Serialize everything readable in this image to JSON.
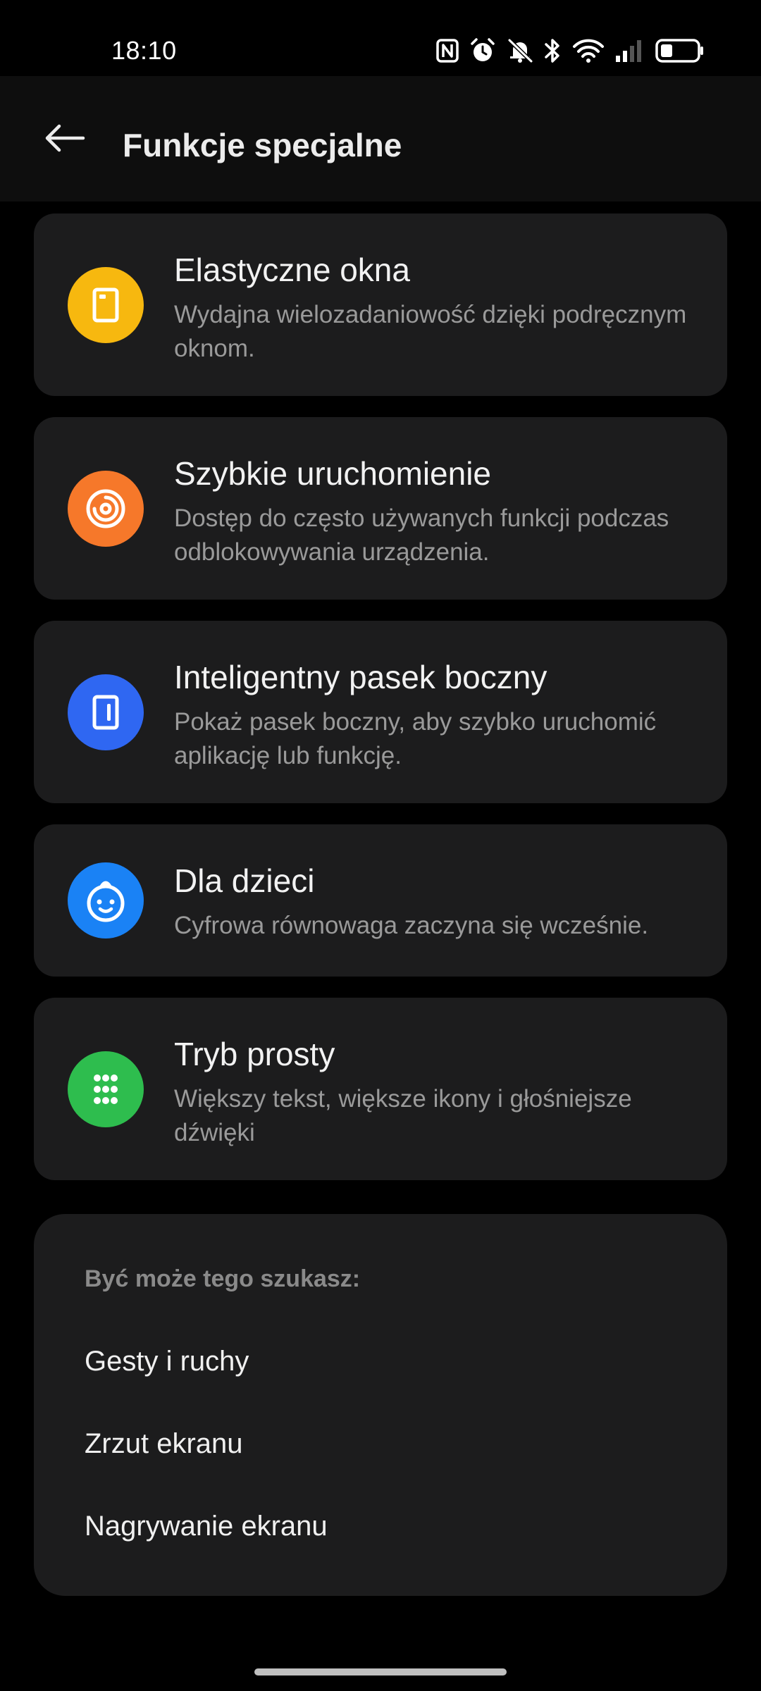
{
  "status_bar": {
    "time": "18:10",
    "icons": [
      "nfc-icon",
      "alarm-icon",
      "silent-icon",
      "bluetooth-icon",
      "wifi-icon",
      "signal-icon",
      "battery-icon"
    ]
  },
  "header": {
    "back_icon": "back-arrow-icon",
    "title": "Funkcje specjalne"
  },
  "features": [
    {
      "title": "Elastyczne okna",
      "description": "Wydajna wielozadaniowość dzięki podręcznym oknom.",
      "icon": "floating-window-icon",
      "icon_color": "#f7b80f"
    },
    {
      "title": "Szybkie uruchomienie",
      "description": "Dostęp do często używanych funkcji podczas odblokowywania urządzenia.",
      "icon": "quick-launch-icon",
      "icon_color": "#f6782a"
    },
    {
      "title": "Inteligentny pasek boczny",
      "description": "Pokaż pasek boczny, aby szybko uruchomić aplikację lub funkcję.",
      "icon": "sidebar-icon",
      "icon_color": "#2f67f2"
    },
    {
      "title": "Dla dzieci",
      "description": "Cyfrowa równowaga zaczyna się wcześnie.",
      "icon": "kid-face-icon",
      "icon_color": "#1a82f5"
    },
    {
      "title": "Tryb prosty",
      "description": "Większy tekst, większe ikony i głośniejsze dźwięki",
      "icon": "grid-dots-icon",
      "icon_color": "#2ebd4e"
    }
  ],
  "suggestions": {
    "title": "Być może tego szukasz:",
    "items": [
      "Gesty i ruchy",
      "Zrzut ekranu",
      "Nagrywanie ekranu"
    ]
  }
}
